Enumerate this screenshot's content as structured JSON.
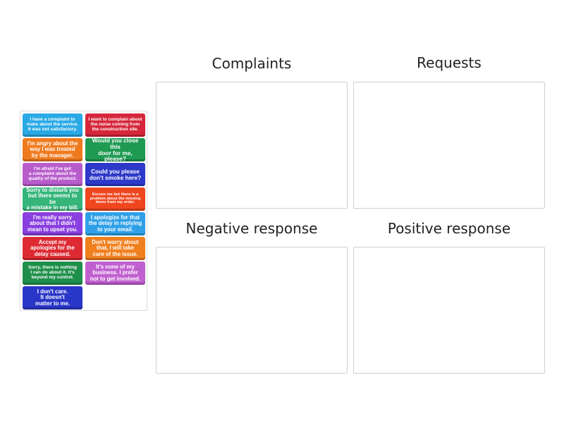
{
  "zones": {
    "complaints": {
      "title": "Complaints"
    },
    "requests": {
      "title": "Requests"
    },
    "negative": {
      "title": "Negative response"
    },
    "positive": {
      "title": "Positive response"
    }
  },
  "cards": [
    {
      "text": "I have a complaint to\nmake about the service.\nIt was not satisfactory.",
      "color": "#29a9e6"
    },
    {
      "text": "I want to complain about\nthe noise coming from\nthe construction site.",
      "color": "#d6263a"
    },
    {
      "text": "I'm angry about the\nway I was treated\nby the manager.",
      "color": "#f07b1f"
    },
    {
      "text": "Would you close this\ndoor for me, please?",
      "color": "#1f9a52"
    },
    {
      "text": "I'm afraid I've got\na complaint about the\nquality of the product.",
      "color": "#b85ccc"
    },
    {
      "text": "Could you please\ndon't smoke here?",
      "color": "#2d39c9"
    },
    {
      "text": "Sorry to disturb you\nbut there seems to be\na mistake in my bill.",
      "color": "#35b57a"
    },
    {
      "text": "Excuse me but there is a\nproblem about the missing\nitems from my order.",
      "color": "#f0461e"
    },
    {
      "text": "I'm really sorry\nabout that I didn't\nmean to upset you.",
      "color": "#8a3fe0"
    },
    {
      "text": "I apologize for that\nthe delay in replying\nto your email.",
      "color": "#2fa0e8"
    },
    {
      "text": "Accept my\napologies for the\ndelay caused.",
      "color": "#dd2a33"
    },
    {
      "text": "Don't worry about\nthat, I will take\ncare of the issue.",
      "color": "#f0801e"
    },
    {
      "text": "Sorry, there is nothing\nI can do about it. It's\nbeyond my control.",
      "color": "#1e8f4a"
    },
    {
      "text": "It's none of my\nbusiness. I prefer\nnot to get involved.",
      "color": "#c05fd0"
    },
    {
      "text": "I don't care.\nIt doesn't\nmatter to me.",
      "color": "#2a36c8"
    }
  ]
}
